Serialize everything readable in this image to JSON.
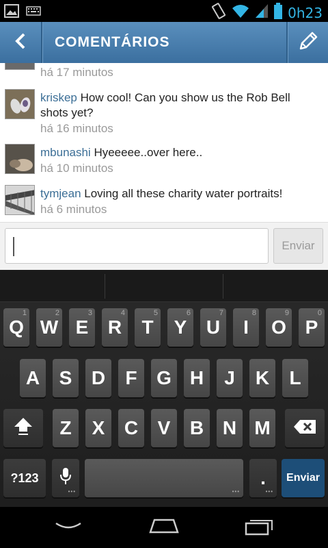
{
  "status_bar": {
    "time": "0h23",
    "icons": [
      "picture-icon",
      "keyboard-icon",
      "vibrate-icon",
      "wifi-icon",
      "signal-icon",
      "battery-icon"
    ]
  },
  "action_bar": {
    "title": "COMENTÁRIOS",
    "back_icon": "chevron-left-icon",
    "edit_icon": "pencil-icon",
    "color": "#4a80b0"
  },
  "comments": [
    {
      "username": "",
      "text": "",
      "time": "há 17 minutos"
    },
    {
      "username": "kriskep",
      "text": " How cool! Can you show us the Rob Bell shots yet?",
      "time": "há 16 minutos"
    },
    {
      "username": "mbunashi",
      "text": " Hyeeeee..over here..",
      "time": "há 10 minutos"
    },
    {
      "username": "tymjean",
      "text": " Loving all these charity water portraits!",
      "time": "há 6 minutos"
    }
  ],
  "composer": {
    "value": "",
    "send_label": "Enviar"
  },
  "keyboard": {
    "row1": [
      {
        "k": "Q",
        "s": "1"
      },
      {
        "k": "W",
        "s": "2"
      },
      {
        "k": "E",
        "s": "3"
      },
      {
        "k": "R",
        "s": "4"
      },
      {
        "k": "T",
        "s": "5"
      },
      {
        "k": "Y",
        "s": "6"
      },
      {
        "k": "U",
        "s": "7"
      },
      {
        "k": "I",
        "s": "8"
      },
      {
        "k": "O",
        "s": "9"
      },
      {
        "k": "P",
        "s": "0"
      }
    ],
    "row2": [
      "A",
      "S",
      "D",
      "F",
      "G",
      "H",
      "J",
      "K",
      "L"
    ],
    "row3": [
      "Z",
      "X",
      "C",
      "V",
      "B",
      "N",
      "M"
    ],
    "symbols_label": "?123",
    "period_label": ".",
    "enter_label": "Enviar",
    "accent": "#1d4e78"
  },
  "nav_bar": {
    "icons": [
      "back-icon",
      "home-icon",
      "recents-icon"
    ]
  }
}
